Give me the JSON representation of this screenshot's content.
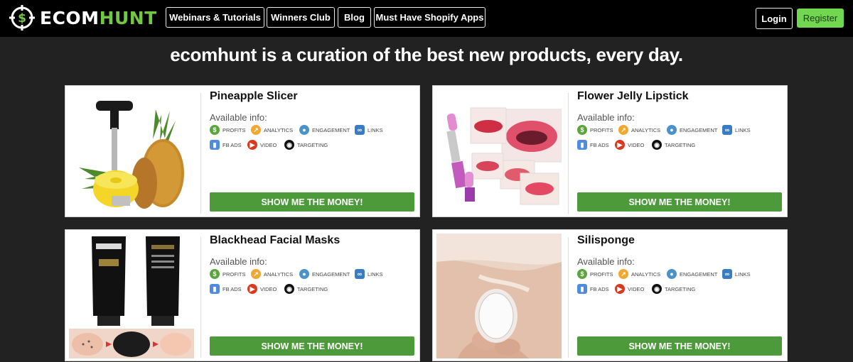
{
  "nav": {
    "logo_part1": "ECOM",
    "logo_part2": "HUNT",
    "links": [
      "Webinars & Tutorials",
      "Winners Club",
      "Blog",
      "Must Have Shopify Apps"
    ],
    "login": "Login",
    "register": "Register"
  },
  "headline": "ecomhunt is a curation of the best new products, every day.",
  "cta": "SHOW ME THE MONEY!",
  "available_label": "Available info:",
  "info_tags": [
    "PROFITS",
    "ANALYTICS",
    "ENGAGEMENT",
    "LINKS",
    "FB ADS",
    "VIDEO",
    "TARGETING"
  ],
  "products": [
    {
      "title": "Pineapple Slicer"
    },
    {
      "title": "Flower Jelly Lipstick"
    },
    {
      "title": "Blackhead Facial Masks"
    },
    {
      "title": "Silisponge"
    }
  ],
  "colors": {
    "accent_green": "#72c743",
    "button_green": "#4c9a3a",
    "register_green": "#72d650",
    "topbar": "#000000",
    "page_bg": "#222222"
  }
}
